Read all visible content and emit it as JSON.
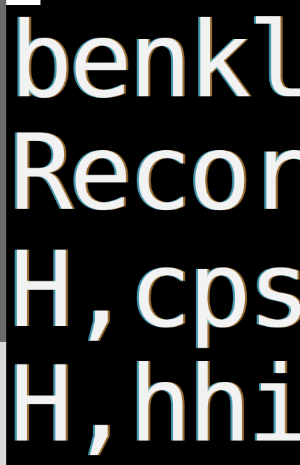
{
  "terminal": {
    "lines": [
      "benkla",
      "Record",
      "H,cpsi",
      "H,hhid"
    ],
    "colors": {
      "background": "#000000",
      "text": "#f2f2f2",
      "scrollbar_thumb": "#6b6b6b",
      "scrollbar_lower": "#d9d9d9"
    }
  }
}
